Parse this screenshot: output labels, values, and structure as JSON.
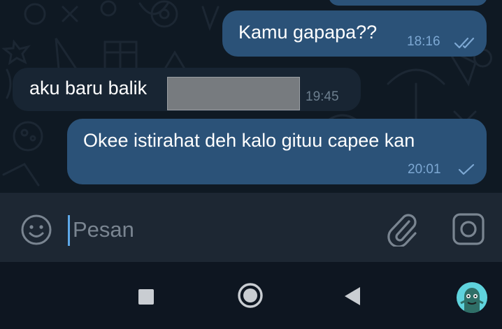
{
  "messages": [
    {
      "direction": "out",
      "text": "Kamu gapapa??",
      "time": "18:16",
      "status": "read"
    },
    {
      "direction": "in",
      "text": "aku baru balik",
      "time": "19:45",
      "redacted": true
    },
    {
      "direction": "out",
      "text": "Okee istirahat deh kalo gituu capee kan",
      "time": "20:01",
      "status": "sent"
    }
  ],
  "composer": {
    "placeholder": "Pesan",
    "value": "",
    "emoji_icon": "emoji-icon",
    "attach_icon": "paperclip-icon",
    "camera_icon": "camera-icon"
  },
  "nav": {
    "recents_icon": "square-icon",
    "home_icon": "circle-icon",
    "back_icon": "triangle-back-icon",
    "assistant_icon": "avatar-icon"
  },
  "colors": {
    "outgoing_bubble": "#2b5278",
    "incoming_bubble": "#182533",
    "background": "#0e1621",
    "input_bar": "#1d2733",
    "timestamp_out": "#7da8d3",
    "accent": "#5ea8e8"
  }
}
